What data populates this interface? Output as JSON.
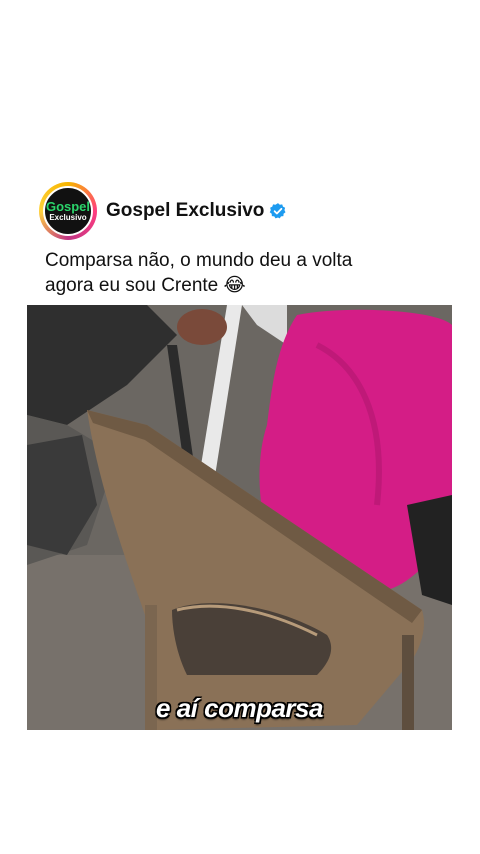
{
  "post": {
    "avatar_line1": "Gospel",
    "avatar_line2": "Exclusivo",
    "account_name": "Gospel Exclusivo",
    "verified_icon": "verified-badge-icon",
    "caption_line1": "Comparsa não, o mundo deu a volta",
    "caption_line2": "agora eu sou Crente 😂"
  },
  "video": {
    "subtitle": "e aí comparsa"
  },
  "colors": {
    "avatar_green": "#2bd46b",
    "verified_blue": "#1d9bf0",
    "shirt_magenta": "#d41d86",
    "chair_brown": "#8a7157"
  }
}
